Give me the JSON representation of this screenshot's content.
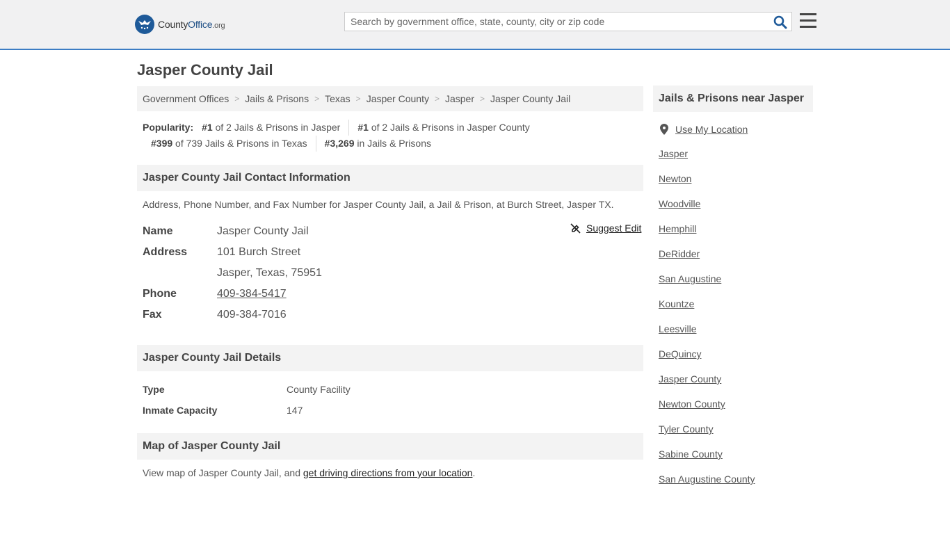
{
  "header": {
    "logo_county": "County",
    "logo_office": "Office",
    "logo_tld": ".org",
    "search_placeholder": "Search by government office, state, county, city or zip code"
  },
  "page_title": "Jasper County Jail",
  "breadcrumbs": [
    "Government Offices",
    "Jails & Prisons",
    "Texas",
    "Jasper County",
    "Jasper",
    "Jasper County Jail"
  ],
  "popularity": {
    "label": "Popularity:",
    "items": [
      {
        "rank": "#1",
        "text": "of 2 Jails & Prisons in Jasper"
      },
      {
        "rank": "#1",
        "text": "of 2 Jails & Prisons in Jasper County"
      },
      {
        "rank": "#399",
        "text": "of 739 Jails & Prisons in Texas"
      },
      {
        "rank": "#3,269",
        "text": "in Jails & Prisons"
      }
    ]
  },
  "contact": {
    "heading": "Jasper County Jail Contact Information",
    "description": "Address, Phone Number, and Fax Number for Jasper County Jail, a Jail & Prison, at Burch Street, Jasper TX.",
    "suggest_edit": "Suggest Edit",
    "name_label": "Name",
    "name": "Jasper County Jail",
    "address_label": "Address",
    "address_line1": "101 Burch Street",
    "address_line2": "Jasper, Texas, 75951",
    "phone_label": "Phone",
    "phone": "409-384-5417",
    "fax_label": "Fax",
    "fax": "409-384-7016"
  },
  "details": {
    "heading": "Jasper County Jail Details",
    "rows": [
      {
        "label": "Type",
        "value": "County Facility"
      },
      {
        "label": "Inmate Capacity",
        "value": "147"
      }
    ]
  },
  "map": {
    "heading": "Map of Jasper County Jail",
    "text_before": "View map of Jasper County Jail, and ",
    "link": "get driving directions from your location",
    "text_after": "."
  },
  "sidebar": {
    "heading": "Jails & Prisons near Jasper",
    "use_location": "Use My Location",
    "links": [
      "Jasper",
      "Newton",
      "Woodville",
      "Hemphill",
      "DeRidder",
      "San Augustine",
      "Kountze",
      "Leesville",
      "DeQuincy",
      "Jasper County",
      "Newton County",
      "Tyler County",
      "Sabine County",
      "San Augustine County"
    ]
  },
  "colors": {
    "accent": "#3c7dc4",
    "brand": "#1e5a99"
  }
}
